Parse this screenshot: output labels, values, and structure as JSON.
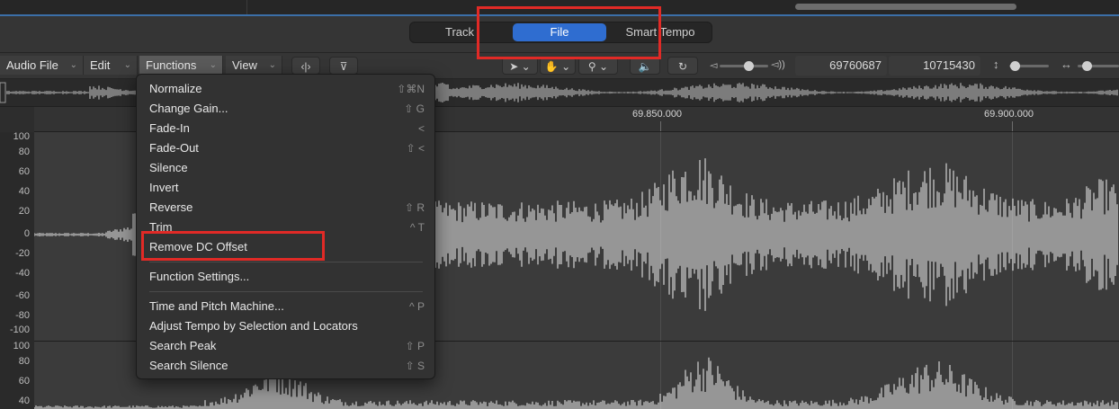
{
  "tabs": [
    {
      "label": "Track"
    },
    {
      "label": "File"
    },
    {
      "label": "Smart Tempo"
    }
  ],
  "toolbar": {
    "menus": [
      "Audio File",
      "Edit",
      "Functions",
      "View"
    ],
    "position_field": "69760687",
    "length_field": "10715430"
  },
  "ruler": {
    "labels": [
      "69.850.000",
      "69.900.000"
    ]
  },
  "yaxis": {
    "labels": [
      "100",
      "80",
      "60",
      "40",
      "20",
      "0",
      "-20",
      "-40",
      "-60",
      "-80",
      "-100",
      "100",
      "80",
      "60",
      "40"
    ]
  },
  "functions_menu": {
    "group1": [
      {
        "label": "Normalize",
        "shortcut": "⇧⌘N"
      },
      {
        "label": "Change Gain...",
        "shortcut": "⇧ G"
      },
      {
        "label": "Fade-In",
        "shortcut": "<"
      },
      {
        "label": "Fade-Out",
        "shortcut": "⇧ <"
      },
      {
        "label": "Silence",
        "shortcut": ""
      },
      {
        "label": "Invert",
        "shortcut": ""
      },
      {
        "label": "Reverse",
        "shortcut": "⇧ R"
      },
      {
        "label": "Trim",
        "shortcut": "^ T"
      },
      {
        "label": "Remove DC Offset",
        "shortcut": ""
      }
    ],
    "settings": {
      "label": "Function Settings..."
    },
    "group2": [
      {
        "label": "Time and Pitch Machine...",
        "shortcut": "^ P"
      },
      {
        "label": "Adjust Tempo by Selection and Locators",
        "shortcut": ""
      },
      {
        "label": "Search Peak",
        "shortcut": "⇧ P"
      },
      {
        "label": "Search Silence",
        "shortcut": "⇧ S"
      }
    ]
  },
  "colors": {
    "accent": "#2f6dd0",
    "highlight": "#e12a26",
    "waveform": "#f2f2f2"
  }
}
